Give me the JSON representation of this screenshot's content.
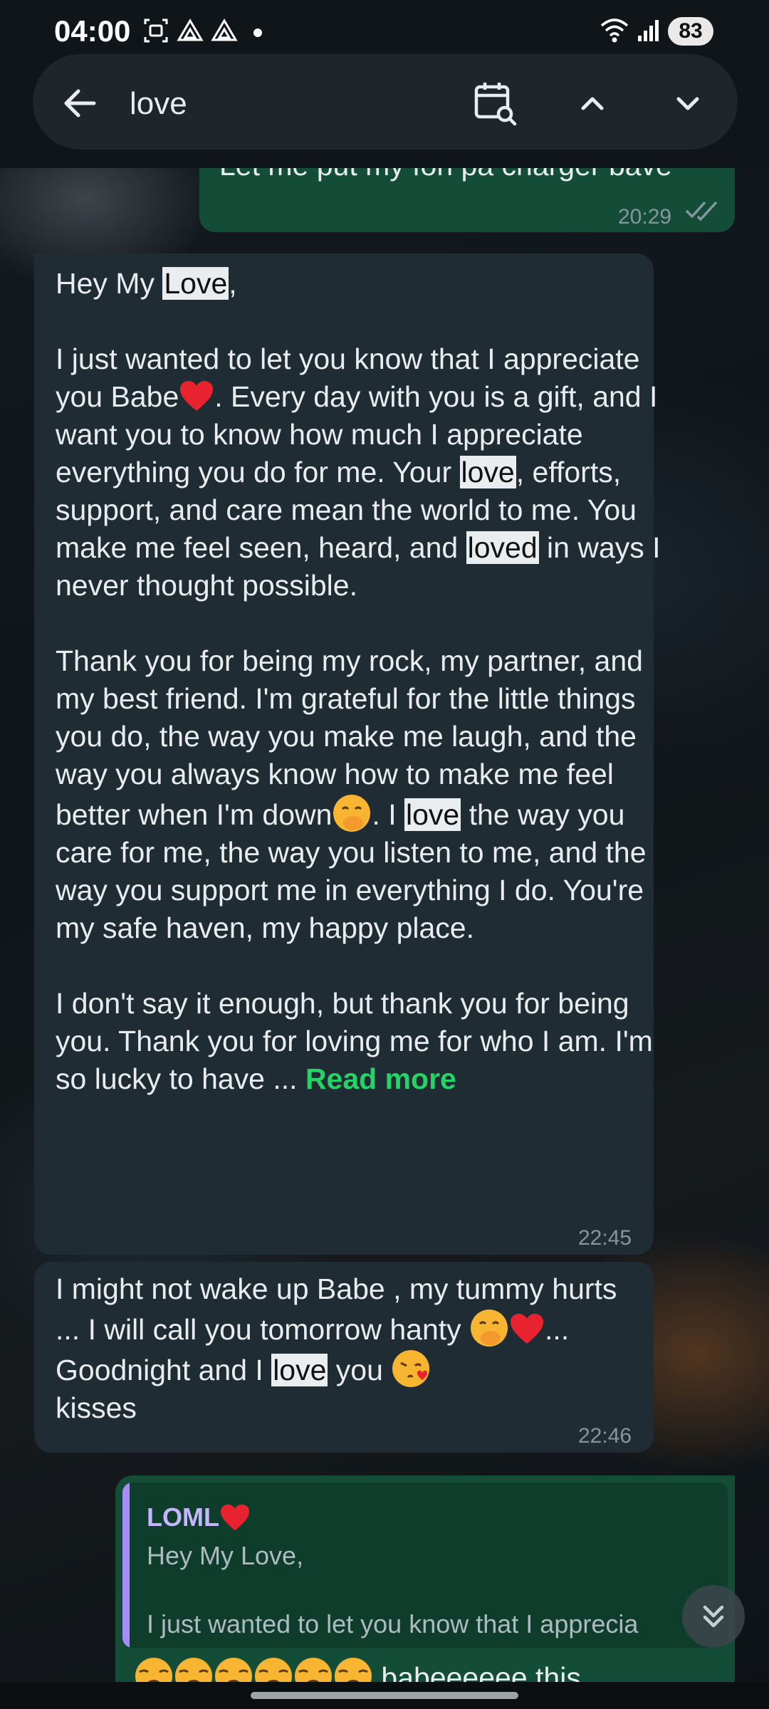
{
  "status_bar": {
    "time": "04:00",
    "battery": "83"
  },
  "search": {
    "query": "love"
  },
  "prev_message": {
    "text": "Let me put my fon pa charger bave",
    "time": "20:29"
  },
  "message1": {
    "greet_pre": "Hey My ",
    "greet_hl": "Love",
    "greet_post": ",",
    "p1_a": "I just wanted to let you know that I appreciate you Babe",
    "p1_b": ". Every day with you is a gift, and I want you to know how much I appreciate everything you do for me. Your ",
    "p1_hl1": "love",
    "p1_c": ", efforts, support, and care mean the world to me. You make me feel seen, heard, and ",
    "p1_hl2": "loved",
    "p1_d": " in ways I never thought possible.",
    "p2_a": "Thank you for being my rock, my partner, and my best friend. I'm grateful for the little things you do, the way you make me laugh, and the way you always know how to make me feel better when I'm down",
    "p2_b": ". I ",
    "p2_hl": "love",
    "p2_c": " the way you care for me, the way you listen to me, and the way you support me in everything I do. You're my safe haven, my happy place.",
    "p3": "I don't say it enough, but thank you for being you. Thank you for loving me for who I am. I'm so lucky to have ... ",
    "read_more": "Read more",
    "time": "22:45"
  },
  "message2": {
    "a": "I might not wake up Babe , my tummy hurts ... I will call you tomorrow hanty ",
    "b": "... Goodnight and I ",
    "hl": "love",
    "c": " you ",
    "d": "kisses",
    "time": "22:46"
  },
  "reply_message": {
    "quote_author": "LOML",
    "quote_line1": "Hey My Love,",
    "quote_line2": "I just wanted to let you know that I apprecia",
    "text": "babeeeeee this"
  },
  "colors": {
    "highlight": "#25d366",
    "incoming": "#202c33",
    "outgoing": "#144d37",
    "quote_bar": "#a78bfa"
  }
}
